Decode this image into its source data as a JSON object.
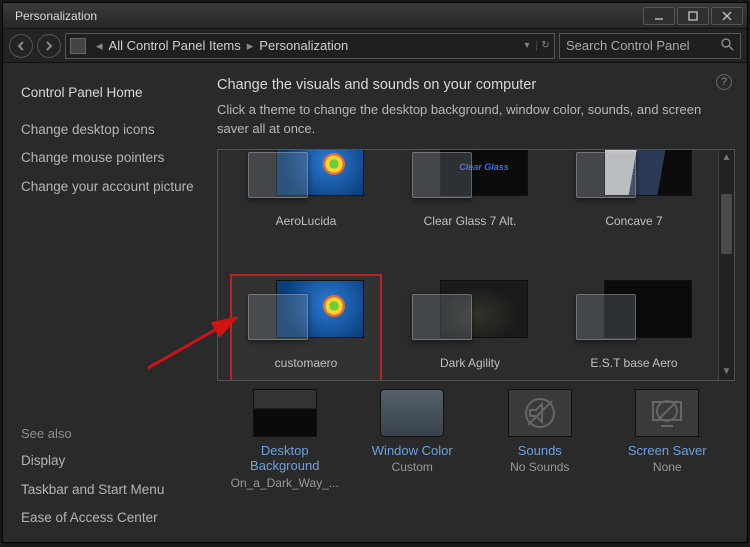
{
  "titlebar": {
    "title": "Personalization"
  },
  "nav": {
    "breadcrumb": [
      {
        "label": "All Control Panel Items"
      },
      {
        "label": "Personalization"
      }
    ],
    "search_placeholder": "Search Control Panel"
  },
  "sidebar": {
    "home": "Control Panel Home",
    "links": [
      "Change desktop icons",
      "Change mouse pointers",
      "Change your account picture"
    ],
    "seealso_heading": "See also",
    "seealso": [
      "Display",
      "Taskbar and Start Menu",
      "Ease of Access Center"
    ]
  },
  "main": {
    "heading": "Change the visuals and sounds on your computer",
    "sub": "Click a theme to change the desktop background, window color, sounds, and screen saver all at once."
  },
  "themes": {
    "row0": [
      {
        "name": "AeroLucida",
        "wall": "win7"
      },
      {
        "name": "Clear Glass 7 Alt.",
        "wall": "clearglass",
        "walltext": "Clear Glass"
      },
      {
        "name": "Concave 7",
        "wall": "concave"
      }
    ],
    "row1": [
      {
        "name": "customaero",
        "wall": "win7",
        "selected": true
      },
      {
        "name": "Dark Agility",
        "wall": "grunge"
      },
      {
        "name": "E.S.T  base Aero",
        "wall": "black"
      }
    ],
    "row2": [
      {
        "name": "",
        "wall": "colorful"
      },
      {
        "name": "",
        "wall": "black"
      },
      {
        "name": "",
        "wall": "cosmic"
      }
    ]
  },
  "actions": {
    "bg": {
      "title": "Desktop Background",
      "value": "On_a_Dark_Way_..."
    },
    "wc": {
      "title": "Window Color",
      "value": "Custom"
    },
    "snd": {
      "title": "Sounds",
      "value": "No Sounds"
    },
    "ss": {
      "title": "Screen Saver",
      "value": "None"
    }
  }
}
